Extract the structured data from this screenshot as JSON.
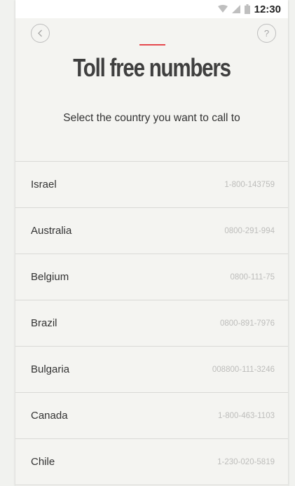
{
  "status_bar": {
    "time": "12:30",
    "icons": [
      "wifi-icon",
      "signal-icon",
      "battery-icon"
    ]
  },
  "header": {
    "back_icon": "chevron-left-icon",
    "help_label": "?",
    "accent_color": "#e5484d",
    "title": "Toll free numbers",
    "subtitle": "Select the country you want to call to"
  },
  "countries": [
    {
      "name": "Israel",
      "number": "1-800-143759"
    },
    {
      "name": "Australia",
      "number": "0800-291-994"
    },
    {
      "name": "Belgium",
      "number": "0800-111-75"
    },
    {
      "name": "Brazil",
      "number": "0800-891-7976"
    },
    {
      "name": "Bulgaria",
      "number": "008800-111-3246"
    },
    {
      "name": "Canada",
      "number": "1-800-463-1103"
    },
    {
      "name": "Chile",
      "number": "1-230-020-5819"
    }
  ]
}
